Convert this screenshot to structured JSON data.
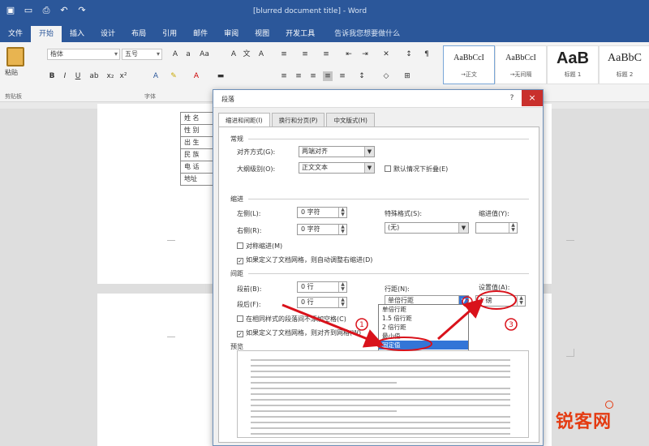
{
  "app": {
    "title": "[blurred document title] - Word",
    "quick_access": [
      "save-icon",
      "folder-icon",
      "print-icon",
      "redo-icon",
      "undo-icon"
    ]
  },
  "ribbon": {
    "tabs": [
      "文件",
      "开始",
      "插入",
      "设计",
      "布局",
      "引用",
      "邮件",
      "审阅",
      "视图",
      "开发工具"
    ],
    "active_tab": "开始",
    "tell_me": "告诉我您想要做什么",
    "paste_label": "粘贴",
    "clipboard_group": "剪贴板",
    "font_group": "字体",
    "font_name": "楷体",
    "font_size": "五号",
    "styles": [
      {
        "preview": "AaBbCcI",
        "name": "→正文"
      },
      {
        "preview": "AaBbCcI",
        "name": "→无间隔"
      },
      {
        "preview": "AaB",
        "name": "标题 1"
      },
      {
        "preview": "AaBbC",
        "name": "标题 2"
      }
    ]
  },
  "document": {
    "table_rows": [
      "姓 名",
      "性 别",
      "出 生",
      "民 族",
      "电 话",
      "地址"
    ]
  },
  "dialog": {
    "title": "段落",
    "help_icon": "?",
    "close_icon": "×",
    "tabs": [
      "缩进和间距(I)",
      "换行和分页(P)",
      "中文版式(H)"
    ],
    "active_tab": "缩进和间距(I)",
    "general": {
      "heading": "常规",
      "alignment_label": "对齐方式(G):",
      "alignment_value": "两端对齐",
      "outline_label": "大纲级别(O):",
      "outline_value": "正文文本",
      "collapsed_label": "默认情况下折叠(E)"
    },
    "indent": {
      "heading": "缩进",
      "left_label": "左侧(L):",
      "left_value": "0 字符",
      "right_label": "右侧(R):",
      "right_value": "0 字符",
      "special_label": "特殊格式(S):",
      "special_value": "(无)",
      "by_label": "缩进值(Y):",
      "mirror_label": "对称缩进(M)",
      "auto_adjust_label": "如果定义了文档网格，则自动调整右缩进(D)"
    },
    "spacing": {
      "heading": "间距",
      "before_label": "段前(B):",
      "before_value": "0 行",
      "after_label": "段后(F):",
      "after_value": "0 行",
      "line_spacing_label": "行距(N):",
      "line_spacing_value": "单倍行距",
      "at_label": "设置值(A):",
      "at_value": "1 磅",
      "no_space_label": "在相同样式的段落间不添加空格(C)",
      "snap_grid_label": "如果定义了文档网格，则对齐到网格(W)",
      "dropdown_options": [
        "单倍行距",
        "1.5 倍行距",
        "2 倍行距",
        "最小值",
        "固定值",
        "多倍行距"
      ],
      "selected_option": "固定值"
    },
    "preview": {
      "heading": "预览"
    }
  },
  "annotation": {
    "circle_numbers": [
      "1",
      "2",
      "3"
    ],
    "arrow_color": "#d9121b"
  },
  "watermark": {
    "text": "锐客网"
  }
}
